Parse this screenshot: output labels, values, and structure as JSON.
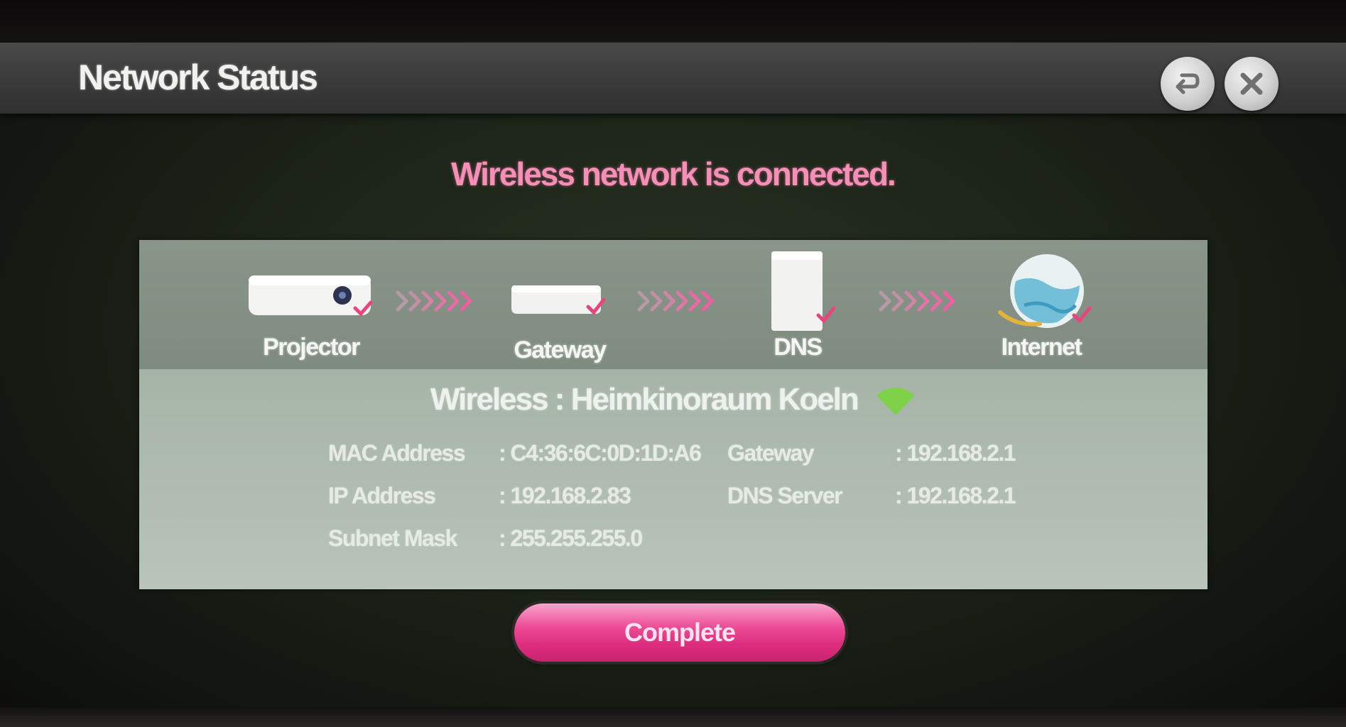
{
  "header": {
    "title": "Network Status",
    "back_icon": "back-arrow-icon",
    "close_icon": "close-icon"
  },
  "status_message": "Wireless network is connected.",
  "diagram": {
    "nodes": [
      {
        "label": "Projector",
        "icon": "projector-icon"
      },
      {
        "label": "Gateway",
        "icon": "gateway-icon"
      },
      {
        "label": "DNS",
        "icon": "dns-server-icon"
      },
      {
        "label": "Internet",
        "icon": "globe-icon"
      }
    ],
    "connector_icon": "chevron-arrows-icon"
  },
  "connection": {
    "prefix": "Wireless : ",
    "network_name": "Heimkinoraum Koeln",
    "signal_icon": "wifi-signal-icon"
  },
  "details": {
    "mac_label": "MAC Address",
    "mac_value": ": C4:36:6C:0D:1D:A6",
    "ip_label": "IP Address",
    "ip_value": ": 192.168.2.83",
    "subnet_label": "Subnet Mask",
    "subnet_value": ": 255.255.255.0",
    "gateway_label": "Gateway",
    "gateway_value": ": 192.168.2.1",
    "dns_label": "DNS Server",
    "dns_value": ": 192.168.2.1"
  },
  "complete_button": "Complete",
  "colors": {
    "accent_pink": "#ee4c97",
    "status_text": "#f58fb6",
    "wifi_green": "#7fd14a"
  }
}
